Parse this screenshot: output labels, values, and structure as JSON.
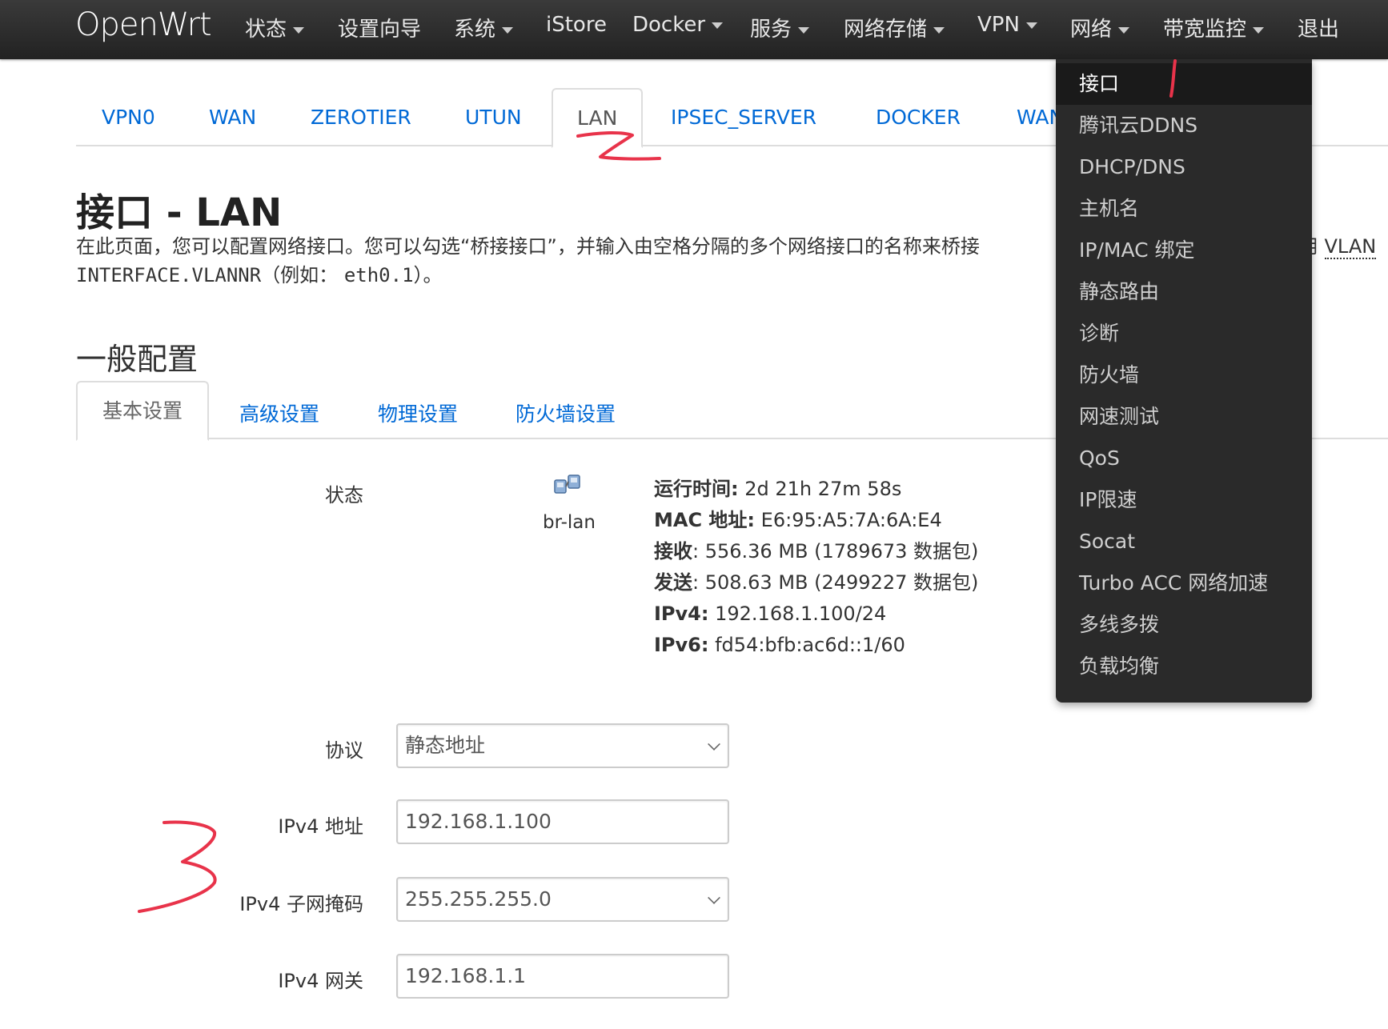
{
  "navbar": {
    "brand": "OpenWrt",
    "items": [
      {
        "label": "状态",
        "dropdown": true
      },
      {
        "label": "设置向导",
        "dropdown": false
      },
      {
        "label": "系统",
        "dropdown": true
      },
      {
        "label": "iStore",
        "dropdown": false
      },
      {
        "label": "Docker",
        "dropdown": true
      },
      {
        "label": "服务",
        "dropdown": true
      },
      {
        "label": "网络存储",
        "dropdown": true
      },
      {
        "label": "VPN",
        "dropdown": true
      },
      {
        "label": "网络",
        "dropdown": true
      },
      {
        "label": "带宽监控",
        "dropdown": true
      },
      {
        "label": "退出",
        "dropdown": false
      }
    ]
  },
  "interface_tabs": [
    "VPN0",
    "WAN",
    "ZEROTIER",
    "UTUN",
    "LAN",
    "IPSEC_SERVER",
    "DOCKER",
    "WAN"
  ],
  "active_interface_tab": "LAN",
  "page": {
    "title": "接口 - LAN",
    "desc_line1_a": "在此页面，您可以配置网络接口。您可以勾选“桥接接口”，并输入由空格分隔的多个网络接口的名称来桥接",
    "desc_line1_b": "使用",
    "desc_line1_abbr": "VLAN",
    "desc_line2_mono1": "INTERFACE.VLANNR",
    "desc_line2_text": "（例如：",
    "desc_line2_mono2": "eth0.1",
    "desc_line2_end": "）。"
  },
  "section": {
    "title": "一般配置",
    "subtabs": [
      "基本设置",
      "高级设置",
      "物理设置",
      "防火墙设置"
    ],
    "active_subtab": "基本设置"
  },
  "status": {
    "label": "状态",
    "iface": "br-lan",
    "uptime_label": "运行时间:",
    "uptime": "2d 21h 27m 58s",
    "mac_label": "MAC 地址:",
    "mac": "E6:95:A5:7A:6A:E4",
    "rx_label": "接收",
    "rx": ": 556.36 MB (1789673 数据包)",
    "tx_label": "发送",
    "tx": ": 508.63 MB (2499227 数据包)",
    "ipv4_label": "IPv4:",
    "ipv4": "192.168.1.100/24",
    "ipv6_label": "IPv6:",
    "ipv6": "fd54:bfb:ac6d::1/60"
  },
  "form": {
    "protocol_label": "协议",
    "protocol_value": "静态地址",
    "ipv4_addr_label": "IPv4 地址",
    "ipv4_addr_value": "192.168.1.100",
    "ipv4_mask_label": "IPv4 子网掩码",
    "ipv4_mask_value": "255.255.255.0",
    "ipv4_gw_label": "IPv4 网关",
    "ipv4_gw_value": "192.168.1.1"
  },
  "network_menu": [
    "接口",
    "腾讯云DDNS",
    "DHCP/DNS",
    "主机名",
    "IP/MAC 绑定",
    "静态路由",
    "诊断",
    "防火墙",
    "网速测试",
    "QoS",
    "IP限速",
    "Socat",
    "Turbo ACC 网络加速",
    "多线多拨",
    "负载均衡"
  ],
  "network_menu_active": "接口",
  "colors": {
    "accent": "#0069d6",
    "navbar": "#2a2a2a",
    "annotation": "#e8334a"
  }
}
